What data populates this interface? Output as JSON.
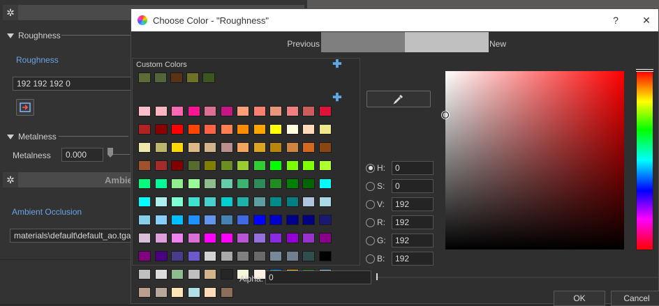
{
  "panel": {
    "roughness_section": "Roughness",
    "roughness_link": "Roughness",
    "roughness_value": "192 192 192 0",
    "metalness_section": "Metalness",
    "metalness_label": "Metalness",
    "metalness_value": "0.000",
    "ambient_header": "Ambie",
    "ambient_link": "Ambient Occlusion",
    "ambient_path": "materials\\default\\default_ao.tga"
  },
  "dialog": {
    "title": "Choose Color - \"Roughness\"",
    "help": "?",
    "close": "✕",
    "previous_label": "Previous",
    "new_label": "New",
    "previous_color": "#7f7f7f",
    "new_color": "#c0c0c0",
    "custom_colors_label": "Custom Colors",
    "custom_colors": [
      "#5d6b35",
      "#55653a",
      "#5a3316",
      "#6f7127",
      "#3d5620"
    ],
    "basic_colors": [
      [
        "#ffc0cb",
        "#ffb6c1",
        "#ff69b4",
        "#ff1493",
        "#db7093",
        "#c71585",
        "#ffa07a",
        "#fa8072",
        "#e9967a",
        "#f08080",
        "#cd5c5c",
        "#dc143c"
      ],
      [
        "#b22222",
        "#8b0000",
        "#ff0000",
        "#ff4500",
        "#ff6347",
        "#ff7f50",
        "#ff8c00",
        "#ffa500",
        "#ffff00",
        "#ffffe0",
        "#ffdab9",
        "#f0e68c"
      ],
      [
        "#eee8aa",
        "#bdb76b",
        "#ffd700",
        "#deb887",
        "#d2b48c",
        "#bc8f8f",
        "#f4a460",
        "#daa520",
        "#b8860b",
        "#cd853f",
        "#d2691e",
        "#8b4513"
      ],
      [
        "#a0522d",
        "#a52a2a",
        "#800000",
        "#556b2f",
        "#808000",
        "#6b8e23",
        "#9acd32",
        "#32cd32",
        "#00ff00",
        "#7cfc00",
        "#7fff00",
        "#adff2f"
      ],
      [
        "#00ff7f",
        "#00fa9a",
        "#90ee90",
        "#98fb98",
        "#8fbc8f",
        "#66cdaa",
        "#3cb371",
        "#2e8b57",
        "#228b22",
        "#008000",
        "#006400",
        "#00ffff"
      ],
      [
        "#00ffff",
        "#afeeee",
        "#7fffd4",
        "#40e0d0",
        "#48d1cc",
        "#00ced1",
        "#20b2aa",
        "#5f9ea0",
        "#008b8b",
        "#008080",
        "#b0c4de",
        "#add8e6"
      ],
      [
        "#87ceeb",
        "#87cefa",
        "#00bfff",
        "#1e90ff",
        "#6495ed",
        "#4682b4",
        "#4169e1",
        "#0000ff",
        "#0000cd",
        "#00008b",
        "#000080",
        "#191970"
      ],
      [
        "#d8bfd8",
        "#dda0dd",
        "#ee82ee",
        "#da70d6",
        "#ff00ff",
        "#ff00ff",
        "#ba55d3",
        "#9370db",
        "#8a2be2",
        "#9400d3",
        "#9932cc",
        "#8b008b"
      ],
      [
        "#800080",
        "#4b0082",
        "#483d8b",
        "#6a5acd",
        "#d3d3d3",
        "#a9a9a9",
        "#808080",
        "#696969",
        "#778899",
        "#708090",
        "#2f4f4f",
        "#000000"
      ],
      [
        "#c0c0c0",
        "#dcdcdc",
        "#8fbc8f",
        "#bfbfbf",
        "#d2b48c",
        "#262626",
        "#f5f5dc",
        "#faf0e6",
        "#00a2ff",
        "#ffc800",
        "#2e8b1e",
        "#87cefa"
      ],
      [
        "#bc9f8f",
        "#b8a89a",
        "#ffe4b5",
        "#b0e0e6",
        "#ffdab9",
        "#8b6f5a"
      ]
    ],
    "fields": [
      {
        "label": "H:",
        "value": "0",
        "selected": true
      },
      {
        "label": "S:",
        "value": "0",
        "selected": false
      },
      {
        "label": "V:",
        "value": "192",
        "selected": false
      },
      {
        "label": "R:",
        "value": "192",
        "selected": false
      },
      {
        "label": "G:",
        "value": "192",
        "selected": false
      },
      {
        "label": "B:",
        "value": "192",
        "selected": false
      }
    ],
    "alpha_label": "Alpha:",
    "alpha_value": "0",
    "ok": "OK",
    "cancel": "Cancel"
  }
}
